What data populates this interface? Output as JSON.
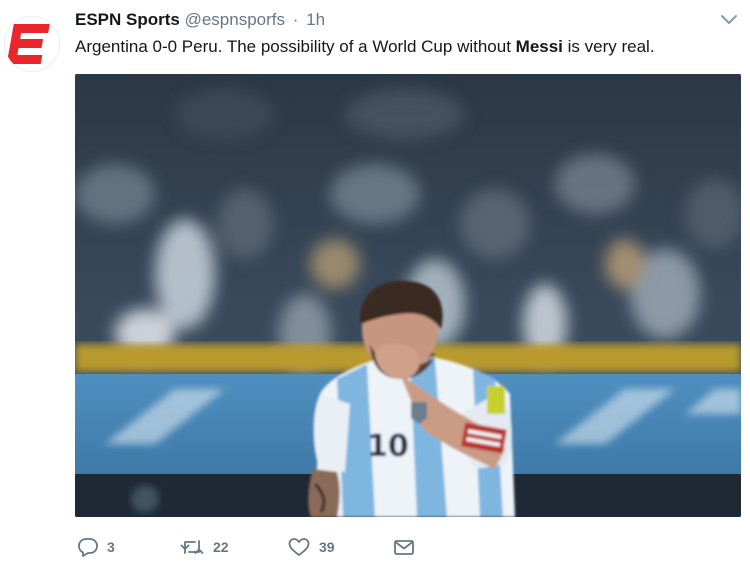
{
  "tweet": {
    "display_name": "ESPN Sports",
    "handle": "@espnsporfs",
    "separator": "·",
    "time": "1h",
    "text_before": "Argentina 0-0 Peru. The possibility of a World Cup without ",
    "text_bold": "Messi",
    "text_after": " is very real.",
    "media_alt": "Lionel Messi wearing an Argentina number 10 shirt, head lowered, holding his shirt to his mouth in front of a blurred stadium crowd"
  },
  "actions": {
    "reply_count": "3",
    "retweet_count": "22",
    "like_count": "39"
  },
  "colors": {
    "brand_red": "#e8262b",
    "meta_gray": "#657786",
    "text_dark": "#14171a"
  },
  "icons": {
    "avatar": "espn-logo-icon",
    "caret": "chevron-down-icon",
    "reply": "reply-icon",
    "retweet": "retweet-icon",
    "like": "heart-icon",
    "dm": "envelope-icon"
  }
}
